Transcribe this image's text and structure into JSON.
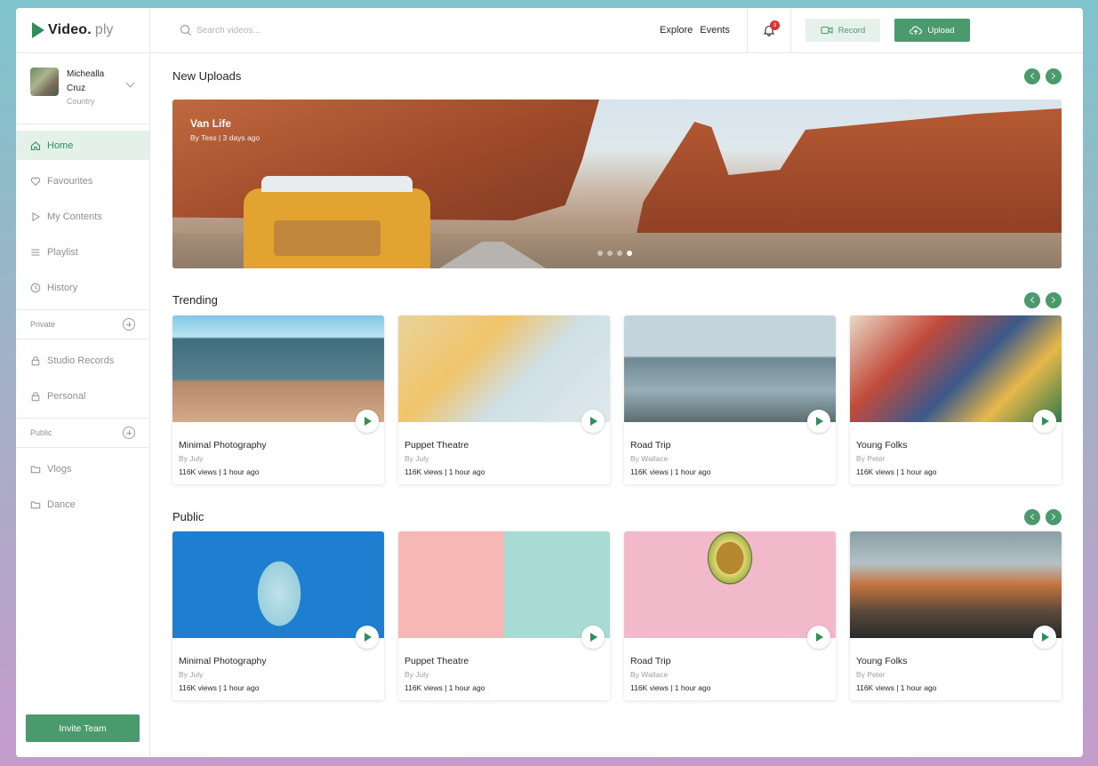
{
  "brand": {
    "name": "Video.",
    "suffix": "ply"
  },
  "profile": {
    "name": "Michealla Cruz",
    "subtitle": "Country"
  },
  "nav": [
    {
      "label": "Home",
      "icon": "home-icon",
      "active": true
    },
    {
      "label": "Favourites",
      "icon": "heart-icon",
      "active": false
    },
    {
      "label": "My Contents",
      "icon": "play-outline-icon",
      "active": false
    },
    {
      "label": "Playlist",
      "icon": "list-icon",
      "active": false
    },
    {
      "label": "History",
      "icon": "clock-icon",
      "active": false
    }
  ],
  "private_section": {
    "label": "Private",
    "items": [
      "Studio Records",
      "Personal"
    ]
  },
  "public_section": {
    "label": "Public",
    "items": [
      "Vlogs",
      "Dance"
    ]
  },
  "invite_label": "Invite Team",
  "header": {
    "search_placeholder": "Search videos...",
    "links": [
      "Explore",
      "Events"
    ],
    "notification_count": "3",
    "record_label": "Record",
    "upload_label": "Upload"
  },
  "new_uploads": {
    "title": "New Uploads",
    "hero": {
      "title": "Van Life",
      "by": "By Tess",
      "time": "3 days ago"
    }
  },
  "trending": {
    "title": "Trending",
    "cards": [
      {
        "title": "Minimal Photography",
        "by": "By July",
        "views": "116K views",
        "time": "1 hour ago"
      },
      {
        "title": "Puppet Theatre",
        "by": "By July",
        "views": "116K views",
        "time": "1 hour ago"
      },
      {
        "title": "Road Trip",
        "by": "By Wallace",
        "views": "116K views",
        "time": "1 hour ago"
      },
      {
        "title": "Young Folks",
        "by": "By Peter",
        "views": "116K views",
        "time": "1 hour ago"
      }
    ]
  },
  "public": {
    "title": "Public",
    "cards": [
      {
        "title": "Minimal Photography",
        "by": "By July",
        "views": "116K views",
        "time": "1 hour ago"
      },
      {
        "title": "Puppet Theatre",
        "by": "By July",
        "views": "116K views",
        "time": "1 hour ago"
      },
      {
        "title": "Road Trip",
        "by": "By Wallace",
        "views": "116K views",
        "time": "1 hour ago"
      },
      {
        "title": "Young Folks",
        "by": "By Peter",
        "views": "116K views",
        "time": "1 hour ago"
      }
    ]
  },
  "colors": {
    "accent": "#4a9a6e",
    "accent_light": "#e3f1e9",
    "badge": "#e0312e"
  }
}
